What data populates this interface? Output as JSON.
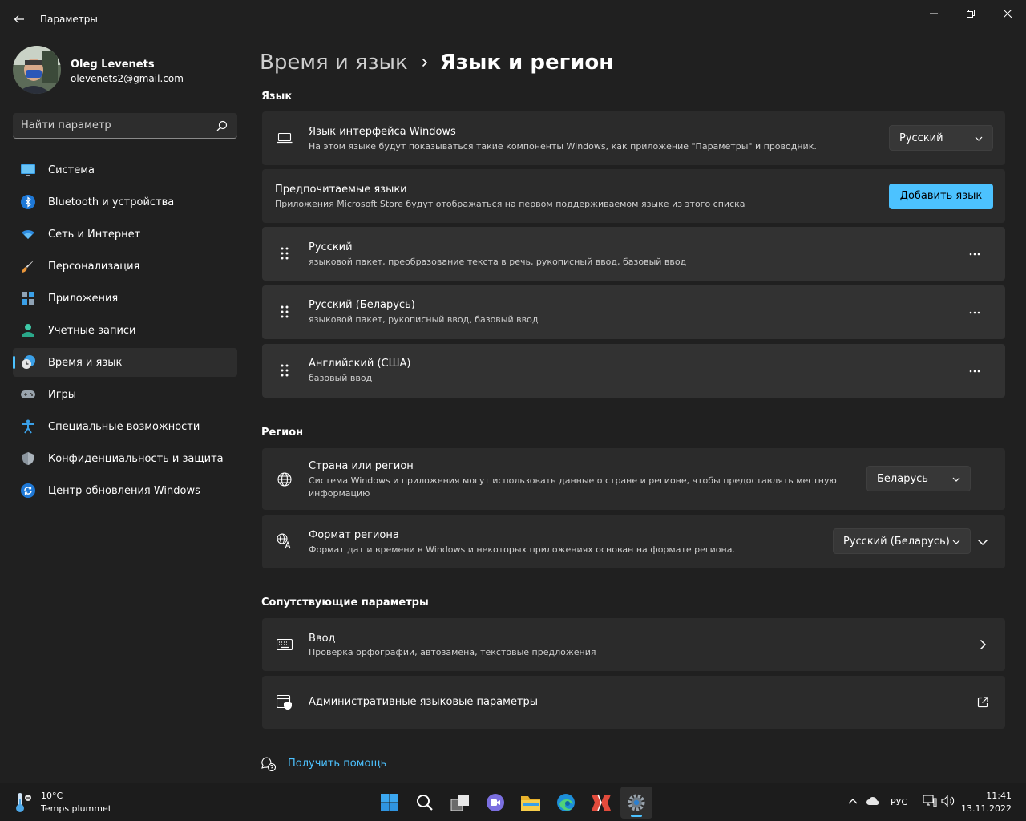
{
  "window": {
    "title": "Параметры"
  },
  "profile": {
    "name": "Oleg Levenets",
    "email": "olevenets2@gmail.com"
  },
  "search": {
    "placeholder": "Найти параметр"
  },
  "sidebar": {
    "items": [
      {
        "label": "Система",
        "icon": "monitor-icon"
      },
      {
        "label": "Bluetooth и устройства",
        "icon": "bluetooth-icon"
      },
      {
        "label": "Сеть и Интернет",
        "icon": "wifi-icon"
      },
      {
        "label": "Персонализация",
        "icon": "brush-icon"
      },
      {
        "label": "Приложения",
        "icon": "apps-icon"
      },
      {
        "label": "Учетные записи",
        "icon": "person-icon"
      },
      {
        "label": "Время и язык",
        "icon": "clock-globe-icon",
        "active": true
      },
      {
        "label": "Игры",
        "icon": "gamepad-icon"
      },
      {
        "label": "Специальные возможности",
        "icon": "accessibility-icon"
      },
      {
        "label": "Конфиденциальность и защита",
        "icon": "shield-icon"
      },
      {
        "label": "Центр обновления Windows",
        "icon": "update-icon"
      }
    ]
  },
  "breadcrumb": {
    "parent": "Время и язык",
    "current": "Язык и регион"
  },
  "language_section": {
    "title": "Язык",
    "display_language": {
      "title": "Язык интерфейса Windows",
      "subtitle": "На этом языке будут показываться такие компоненты Windows, как приложение \"Параметры\" и проводник.",
      "value": "Русский"
    },
    "preferred": {
      "title": "Предпочитаемые языки",
      "subtitle": "Приложения Microsoft Store будут отображаться на первом поддерживаемом языке из этого списка",
      "button": "Добавить язык"
    },
    "languages": [
      {
        "name": "Русский",
        "features": "языковой пакет, преобразование текста в речь, рукописный ввод, базовый ввод"
      },
      {
        "name": "Русский (Беларусь)",
        "features": "языковой пакет, рукописный ввод, базовый ввод"
      },
      {
        "name": "Английский (США)",
        "features": "базовый ввод"
      }
    ]
  },
  "region_section": {
    "title": "Регион",
    "country": {
      "title": "Страна или регион",
      "subtitle_line1": "Система Windows и приложения могут использовать данные о стране и регионе, чтобы предоставлять местную",
      "subtitle_line2": "информацию",
      "value": "Беларусь"
    },
    "format": {
      "title": "Формат региона",
      "subtitle": "Формат дат и времени в Windows и некоторых приложениях основан на формате региона.",
      "value": "Русский (Беларусь)"
    }
  },
  "related_section": {
    "title": "Сопутствующие параметры",
    "typing": {
      "title": "Ввод",
      "subtitle": "Проверка орфографии, автозамена, текстовые предложения"
    },
    "admin": {
      "title": "Административные языковые параметры"
    }
  },
  "help": {
    "label": "Получить помощь"
  },
  "taskbar": {
    "weather_temp": "10°C",
    "weather_desc": "Temps plummet",
    "apps": [
      "start-icon",
      "search-icon",
      "task-view-icon",
      "chat-icon",
      "file-explorer-icon",
      "edge-icon",
      "app-icon",
      "settings-icon"
    ],
    "lang": "РУС",
    "time": "11:41",
    "date": "13.11.2022"
  },
  "colors": {
    "accent": "#4cc2ff",
    "background": "#202020",
    "card": "#2b2b2b"
  }
}
